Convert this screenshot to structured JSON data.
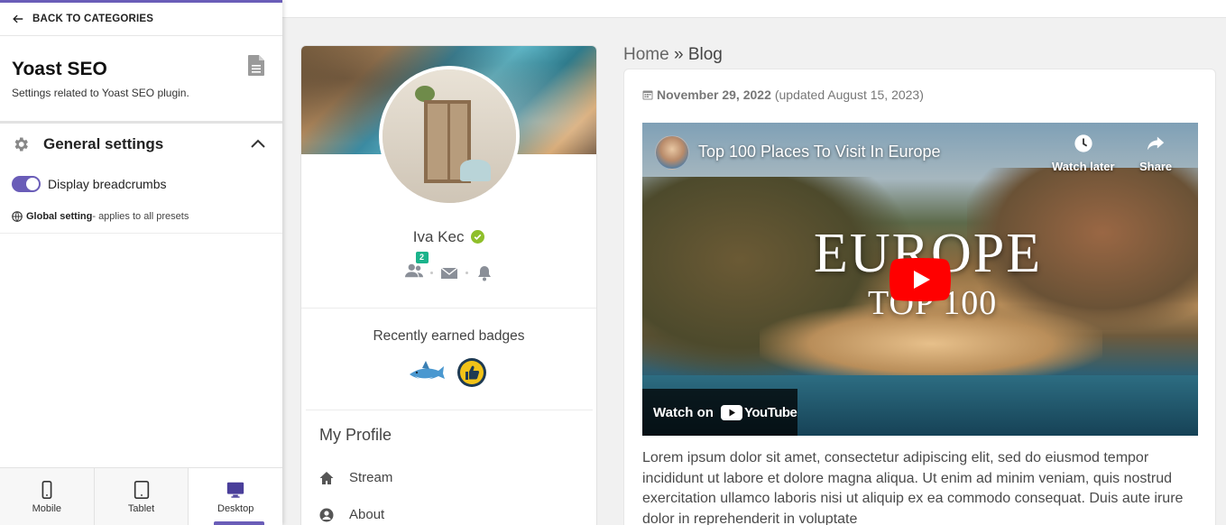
{
  "panel": {
    "back_label": "BACK TO CATEGORIES",
    "plugin_title": "Yoast SEO",
    "plugin_desc": "Settings related to Yoast SEO plugin.",
    "section_label": "General settings",
    "toggle_label": "Display breadcrumbs",
    "toggle_on": true,
    "global_strong": "Global setting",
    "global_rest": " - applies to all presets",
    "devices": [
      {
        "label": "Mobile",
        "icon": "mobile-icon"
      },
      {
        "label": "Tablet",
        "icon": "tablet-icon"
      },
      {
        "label": "Desktop",
        "icon": "desktop-icon",
        "active": true
      }
    ]
  },
  "profile": {
    "name": "Iva Kec",
    "friend_requests": "2",
    "badges_title": "Recently earned badges",
    "menu_title": "My Profile",
    "menu": [
      {
        "label": "Stream",
        "icon": "home-icon"
      },
      {
        "label": "About",
        "icon": "user-circle-icon"
      }
    ]
  },
  "breadcrumb": {
    "home": "Home",
    "sep": " » ",
    "current": "Blog"
  },
  "post": {
    "date": "November 29, 2022",
    "updated": "(updated August 15, 2023)",
    "video": {
      "title": "Top 100 Places To Visit In Europe",
      "watch_later": "Watch later",
      "share": "Share",
      "overlay_big": "EUROPE",
      "overlay_small": "TOP 100",
      "watch_on": "Watch on",
      "youtube": "YouTube"
    },
    "body": "Lorem ipsum dolor sit amet, consectetur adipiscing elit, sed do eiusmod tempor incididunt ut labore et dolore magna aliqua. Ut enim ad minim veniam, quis nostrud exercitation ullamco laboris nisi ut aliquip ex ea commodo consequat. Duis aute irure dolor in reprehenderit in voluptate"
  },
  "colors": {
    "accent": "#6a5db8",
    "verified": "#8fbf2a",
    "badge_count_bg": "#1bb38b",
    "youtube_red": "#ff0000"
  }
}
